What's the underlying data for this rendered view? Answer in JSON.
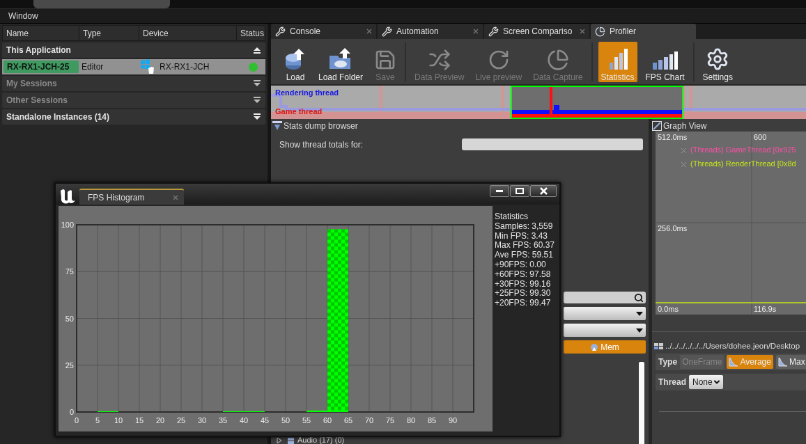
{
  "menu_bar": [
    "Window"
  ],
  "session_browser": {
    "columns": [
      "Name",
      "Type",
      "Device",
      "Status"
    ],
    "groups": [
      {
        "label": "This Application",
        "expanded": true,
        "disabled": false,
        "sessions": [
          {
            "name": "RX-RX1-JCH-25",
            "type": "Editor",
            "device": "RX-RX1-JCH",
            "selected": true,
            "color": "#2ec02e"
          }
        ]
      },
      {
        "label": "My Sessions",
        "expanded": false,
        "disabled": true
      },
      {
        "label": "Other Sessions",
        "expanded": false,
        "disabled": true
      },
      {
        "label": "Standalone Instances (14)",
        "expanded": false,
        "disabled": false
      }
    ]
  },
  "tabs": [
    {
      "label": "Console",
      "selected": false
    },
    {
      "label": "Automation",
      "selected": false
    },
    {
      "label": "Screen Compariso",
      "selected": false
    },
    {
      "label": "Profiler",
      "selected": true
    }
  ],
  "toolbar": [
    [
      {
        "label": "Load",
        "disabled": false,
        "selected": false
      },
      {
        "label": "Load Folder",
        "disabled": false,
        "selected": false
      },
      {
        "label": "Save",
        "disabled": true,
        "selected": false
      }
    ],
    [
      {
        "label": "Data Preview",
        "disabled": true,
        "selected": false
      },
      {
        "label": "Live preview",
        "disabled": true,
        "selected": false
      },
      {
        "label": "Data Capture",
        "disabled": true,
        "selected": false
      }
    ],
    [
      {
        "label": "Statistics",
        "disabled": false,
        "selected": true
      },
      {
        "label": "FPS Chart",
        "disabled": false,
        "selected": false
      }
    ],
    [
      {
        "label": "Settings",
        "disabled": false,
        "selected": false
      }
    ]
  ],
  "timeline": {
    "labels": [
      "Rendering thread",
      "Game thread"
    ]
  },
  "stats_dump": {
    "title": "Stats dump browser",
    "thread_totals_label": "Show thread totals for:",
    "mem_button": {
      "label": "Mem",
      "selected": true
    },
    "tree": [
      {
        "label": "Audio (17) (0)",
        "expanded": false
      }
    ]
  },
  "graph_view": {
    "title": "Graph View",
    "y_labels": [
      "512.0ms",
      "256.0ms",
      "0.0ms"
    ],
    "x_labels": [
      "600",
      "116.9s"
    ],
    "legend": [
      {
        "label": "(Threads) GameThread [0x925",
        "color": "#ff4fa8"
      },
      {
        "label": "(Threads) RenderThread [0x8d",
        "color": "#c6e61a"
      }
    ],
    "path": "../../../../../../Users/dohee.jeon/Desktop",
    "type_label": "Type",
    "type_options": [
      {
        "label": "OneFrame",
        "disabled": true,
        "selected": false
      },
      {
        "label": "Average",
        "disabled": false,
        "selected": true
      },
      {
        "label": "Max",
        "disabled": false,
        "selected": false
      }
    ],
    "thread_label": "Thread",
    "thread_value": "None"
  },
  "fps_histogram": {
    "tab": "FPS Histogram",
    "stats_title": "Statistics",
    "statistics": [
      "Samples: 3,559",
      "Min FPS: 3.43",
      "Max FPS: 60.37",
      "Ave FPS: 59.51",
      "+90FPS: 0.00",
      "+60FPS: 97.58",
      "+30FPS: 99.16",
      "+25FPS: 99.30",
      "+20FPS: 99.47"
    ],
    "chart_data": {
      "type": "bar",
      "x": [
        2.5,
        7.5,
        12.5,
        17.5,
        22.5,
        27.5,
        32.5,
        37.5,
        42.5,
        47.5,
        52.5,
        57.5,
        62.5,
        67.5,
        72.5,
        77.5,
        82.5,
        87.5,
        92.5
      ],
      "series": [
        {
          "color": "#00ff00",
          "values": [
            0,
            0.4,
            0,
            0,
            0,
            0,
            0,
            0.4,
            0.4,
            0,
            0,
            0.8,
            97.6,
            0,
            0,
            0,
            0,
            0,
            0
          ]
        }
      ],
      "xlim": [
        0,
        95
      ],
      "ylim": [
        0,
        100
      ],
      "xticks": [
        0,
        5,
        10,
        15,
        20,
        25,
        30,
        35,
        40,
        45,
        50,
        55,
        60,
        65,
        70,
        75,
        80,
        85,
        90
      ],
      "yticks": [
        0,
        25,
        50,
        75,
        100
      ],
      "grid": true
    }
  }
}
